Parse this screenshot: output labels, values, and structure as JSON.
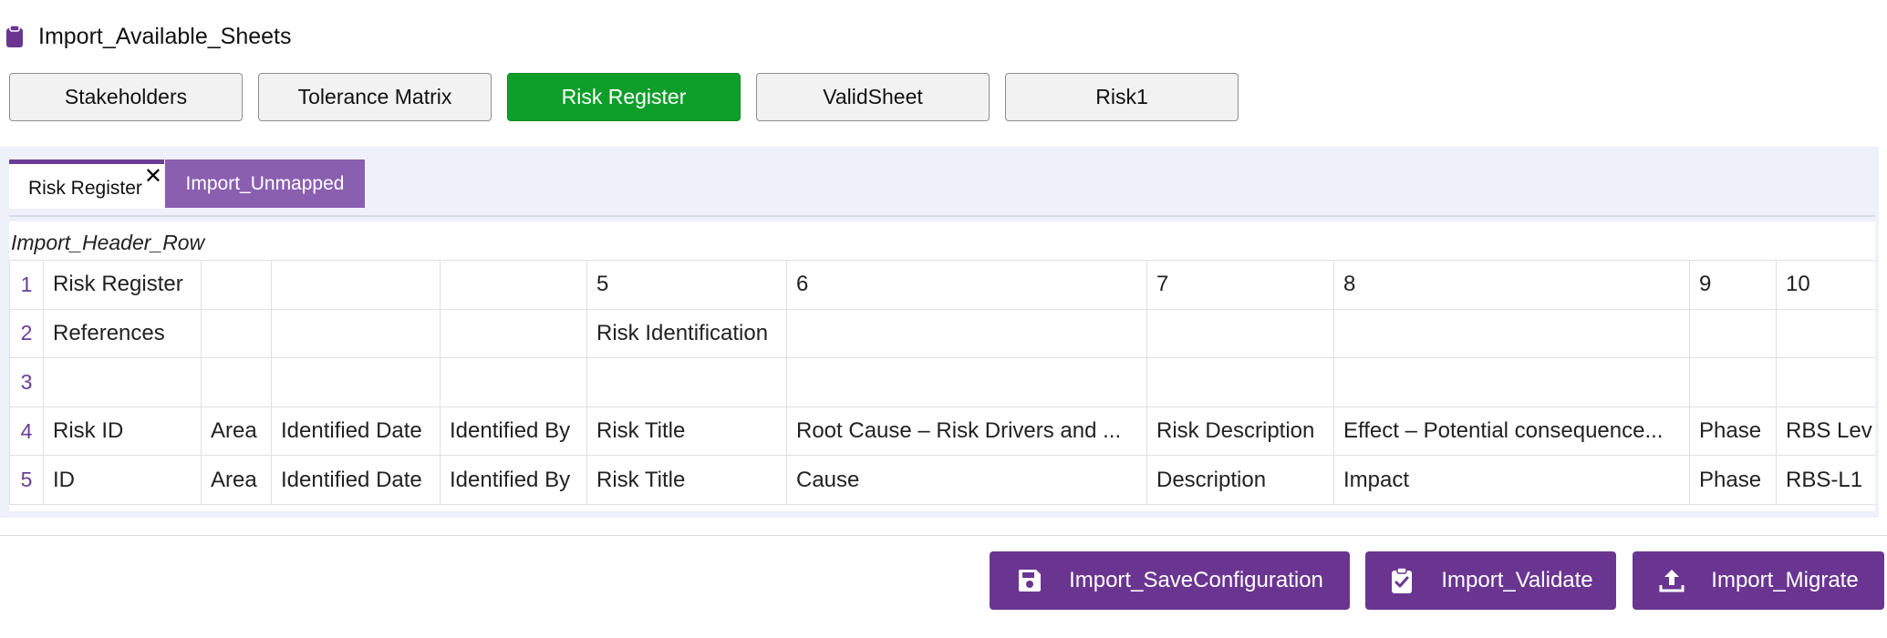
{
  "header": {
    "title": "Import_Available_Sheets",
    "icon": "clipboard-icon"
  },
  "sheet_buttons": [
    {
      "label": "Stakeholders",
      "active": false
    },
    {
      "label": "Tolerance Matrix",
      "active": false
    },
    {
      "label": "Risk Register",
      "active": true
    },
    {
      "label": "ValidSheet",
      "active": false
    },
    {
      "label": "Risk1",
      "active": false
    }
  ],
  "tabs": {
    "active_label": "Risk Register",
    "close_glyph": "✕",
    "second_label": "Import_Unmapped"
  },
  "grid": {
    "header_row_label": "Import_Header_Row",
    "rows": [
      {
        "n": "1",
        "cells": [
          "Risk Register",
          "",
          "",
          "",
          "5",
          "6",
          "7",
          "8",
          "9",
          "10"
        ]
      },
      {
        "n": "2",
        "cells": [
          "References",
          "",
          "",
          "",
          "Risk Identification",
          "",
          "",
          "",
          "",
          ""
        ]
      },
      {
        "n": "3",
        "cells": [
          "",
          "",
          "",
          "",
          "",
          "",
          "",
          "",
          "",
          ""
        ]
      },
      {
        "n": "4",
        "cells": [
          "Risk ID",
          "Area",
          "Identified Date",
          "Identified By",
          "Risk Title",
          "Root Cause – Risk Drivers and ...",
          "Risk Description",
          "Effect – Potential consequence...",
          "Phase",
          "RBS Lev"
        ]
      },
      {
        "n": "5",
        "cells": [
          "ID",
          "Area",
          "Identified Date",
          "Identified By",
          "Risk Title",
          "Cause",
          "Description",
          "Impact",
          "Phase",
          "RBS-L1"
        ]
      }
    ]
  },
  "actions": {
    "save_label": "Import_SaveConfiguration",
    "validate_label": "Import_Validate",
    "migrate_label": "Import_Migrate"
  },
  "colors": {
    "accent": "#6a3591",
    "active_sheet": "#0e9f2a",
    "tab_inactive": "#8a5fb0"
  }
}
